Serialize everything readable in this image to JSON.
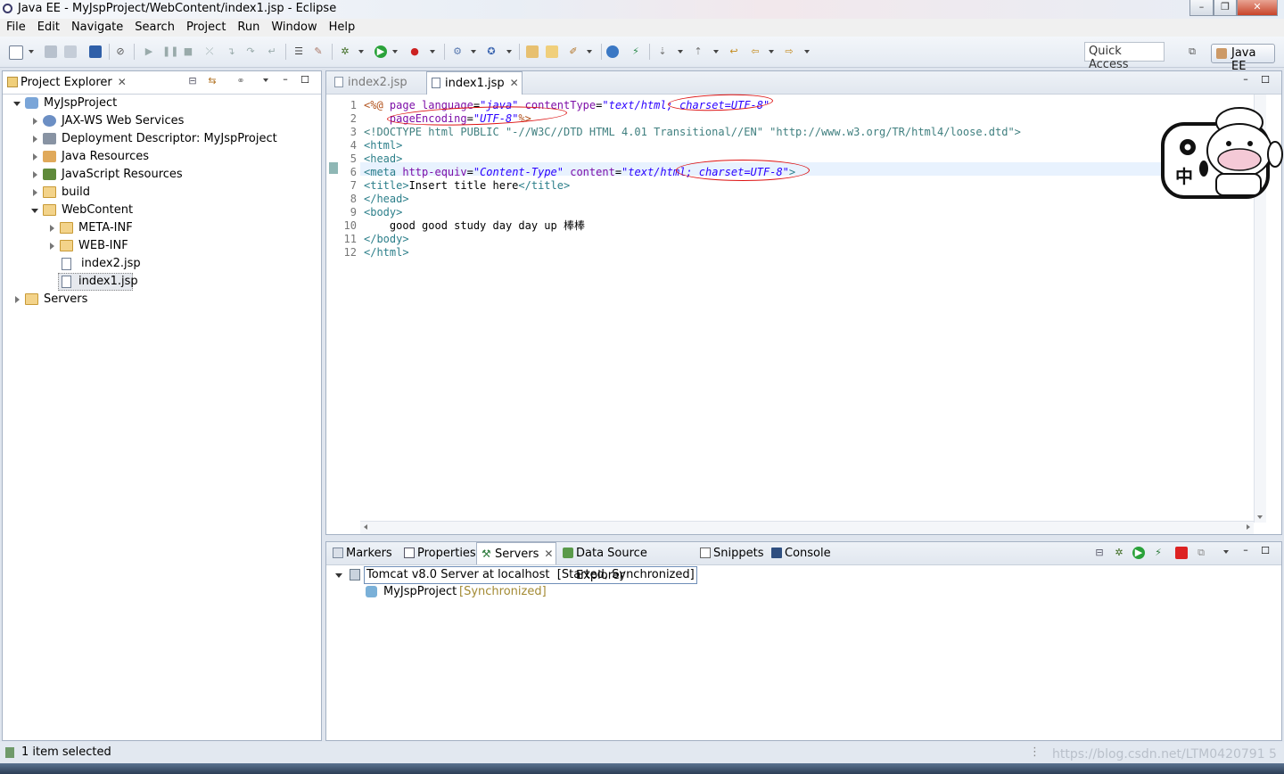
{
  "window": {
    "title": "Java EE - MyJspProject/WebContent/index1.jsp - Eclipse"
  },
  "menu": [
    "File",
    "Edit",
    "Navigate",
    "Search",
    "Project",
    "Run",
    "Window",
    "Help"
  ],
  "toolbar": {
    "quick_access": "Quick Access",
    "perspective": "Java EE"
  },
  "project_explorer": {
    "tab_label": "Project Explorer",
    "tree": [
      {
        "label": "MyJspProject"
      },
      {
        "label": "JAX-WS Web Services"
      },
      {
        "label": "Deployment Descriptor: MyJspProject"
      },
      {
        "label": "Java Resources"
      },
      {
        "label": "JavaScript Resources"
      },
      {
        "label": "build"
      },
      {
        "label": "WebContent"
      },
      {
        "label": "META-INF"
      },
      {
        "label": "WEB-INF"
      },
      {
        "label": "index2.jsp"
      },
      {
        "label": "index1.jsp"
      },
      {
        "label": "Servers"
      }
    ]
  },
  "editor": {
    "tabs": [
      "index2.jsp",
      "index1.jsp"
    ],
    "lines": [
      {
        "num": "1",
        "parts": [
          [
            "dir",
            "<%@ "
          ],
          [
            "attr",
            "page "
          ],
          [
            "attr",
            "language"
          ],
          [
            "txt",
            "="
          ],
          [
            "str",
            "\"java\""
          ],
          [
            "txt",
            " "
          ],
          [
            "attr",
            "contentType"
          ],
          [
            "txt",
            "="
          ],
          [
            "str",
            "\"text/html; charset=UTF-8\""
          ]
        ]
      },
      {
        "num": "2",
        "parts": [
          [
            "txt",
            "    "
          ],
          [
            "attr",
            "pageEncoding"
          ],
          [
            "txt",
            "="
          ],
          [
            "str",
            "\"UTF-8\""
          ],
          [
            "dir",
            "%>"
          ]
        ]
      },
      {
        "num": "3",
        "parts": [
          [
            "doc",
            "<!DOCTYPE html PUBLIC \"-//W3C//DTD HTML 4.01 Transitional//EN\" \"http://www.w3.org/TR/html4/loose.dtd\">"
          ]
        ]
      },
      {
        "num": "4",
        "parts": [
          [
            "tag",
            "<html>"
          ]
        ]
      },
      {
        "num": "5",
        "parts": [
          [
            "tag",
            "<head>"
          ]
        ]
      },
      {
        "num": "6",
        "parts": [
          [
            "tag",
            "<meta "
          ],
          [
            "attr",
            "http-equiv"
          ],
          [
            "txt",
            "="
          ],
          [
            "str",
            "\"Content-Type\""
          ],
          [
            "txt",
            " "
          ],
          [
            "attr",
            "content"
          ],
          [
            "txt",
            "="
          ],
          [
            "str",
            "\"text/html; charset=UTF-8\""
          ],
          [
            "tag",
            ">"
          ]
        ]
      },
      {
        "num": "7",
        "parts": [
          [
            "tag",
            "<title>"
          ],
          [
            "txt",
            "Insert title here"
          ],
          [
            "tag",
            "</title>"
          ]
        ]
      },
      {
        "num": "8",
        "parts": [
          [
            "tag",
            "</head>"
          ]
        ]
      },
      {
        "num": "9",
        "parts": [
          [
            "tag",
            "<body>"
          ]
        ]
      },
      {
        "num": "10",
        "parts": [
          [
            "txt",
            "    good good study day day up 棒棒"
          ]
        ]
      },
      {
        "num": "11",
        "parts": [
          [
            "tag",
            "</body>"
          ]
        ]
      },
      {
        "num": "12",
        "parts": [
          [
            "tag",
            "</html>"
          ]
        ]
      }
    ]
  },
  "bottom_panel": {
    "tabs": [
      "Markers",
      "Properties",
      "Servers",
      "Data Source Explorer",
      "Snippets",
      "Console"
    ],
    "server": {
      "name": "Tomcat v8.0 Server at localhost",
      "state": "[Started, Synchronized]"
    },
    "module": {
      "name": "MyJspProject",
      "state": "[Synchronized]"
    }
  },
  "status": {
    "text": "1 item selected"
  },
  "watermark": "https://blog.csdn.net/LTM0420791 5",
  "mascot": {
    "ime_char": "中"
  }
}
